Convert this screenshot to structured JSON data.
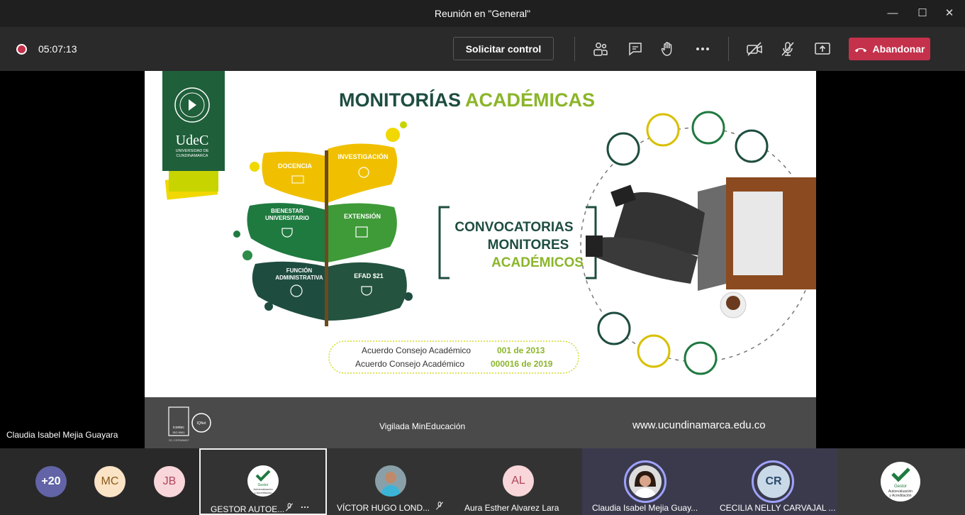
{
  "window": {
    "title": "Reunión en \"General\""
  },
  "toolbar": {
    "timer": "05:07:13",
    "request_control": "Solicitar control",
    "leave": "Abandonar"
  },
  "slide": {
    "title_part1": "MONITORÍAS",
    "title_part2": "ACADÉMICAS",
    "logo_text": "UdeC",
    "logo_sub1": "UNIVERSIDAD DE",
    "logo_sub2": "CUNDINAMARCA",
    "logo_ring": "UNIVERSIDAD DE CUNDINAMARCA",
    "leaves": [
      "DOCENCIA",
      "INVESTIGACIÓN",
      "BIENESTAR",
      "UNIVERSITARIO",
      "EXTENSIÓN",
      "FUNCIÓN",
      "ADMINISTRATIVA",
      "EFAD $21"
    ],
    "box_line1": "CONVOCATORIAS",
    "box_line2": "MONITORES",
    "box_line3": "ACADÉMICOS",
    "agreement1_text": "Acuerdo Consejo Académico",
    "agreement1_num": "001 de 2013",
    "agreement2_text": "Acuerdo Consejo Académico",
    "agreement2_num": "000016 de 2019"
  },
  "footer": {
    "cert1": "icontec",
    "cert2": "ISO 9001",
    "cert3": "IQNet",
    "cert_code": "SC-CER586857",
    "vigilada": "Vigilada MinEducación",
    "url": "www.ucundinamarca.edu.co"
  },
  "presenter": "Claudia Isabel Mejia Guayara",
  "participants": {
    "overflow": "+20",
    "avatars": [
      "MC",
      "JB"
    ],
    "tiles": [
      {
        "name": "GESTOR AUTOE...",
        "logo_l1": "Gestor",
        "logo_l2": "Autoevaluación",
        "logo_l3": "y Acreditación"
      },
      {
        "name": "VÍCTOR HUGO LOND..."
      },
      {
        "name": "Aura Esther Alvarez Lara",
        "initials": "AL"
      },
      {
        "name": "Claudia Isabel Mejia Guay..."
      },
      {
        "name": "CECILIA NELLY CARVAJAL ...",
        "initials": "CR"
      },
      {
        "logo_l1": "Gestor",
        "logo_l2": "Autoevaluación",
        "logo_l3": "y Acreditación"
      }
    ]
  },
  "colors": {
    "teams_red": "#c4314b",
    "udec_green": "#1f5f3a",
    "accent_green": "#8bb52a",
    "ring_purple": "#9ea2ff"
  }
}
